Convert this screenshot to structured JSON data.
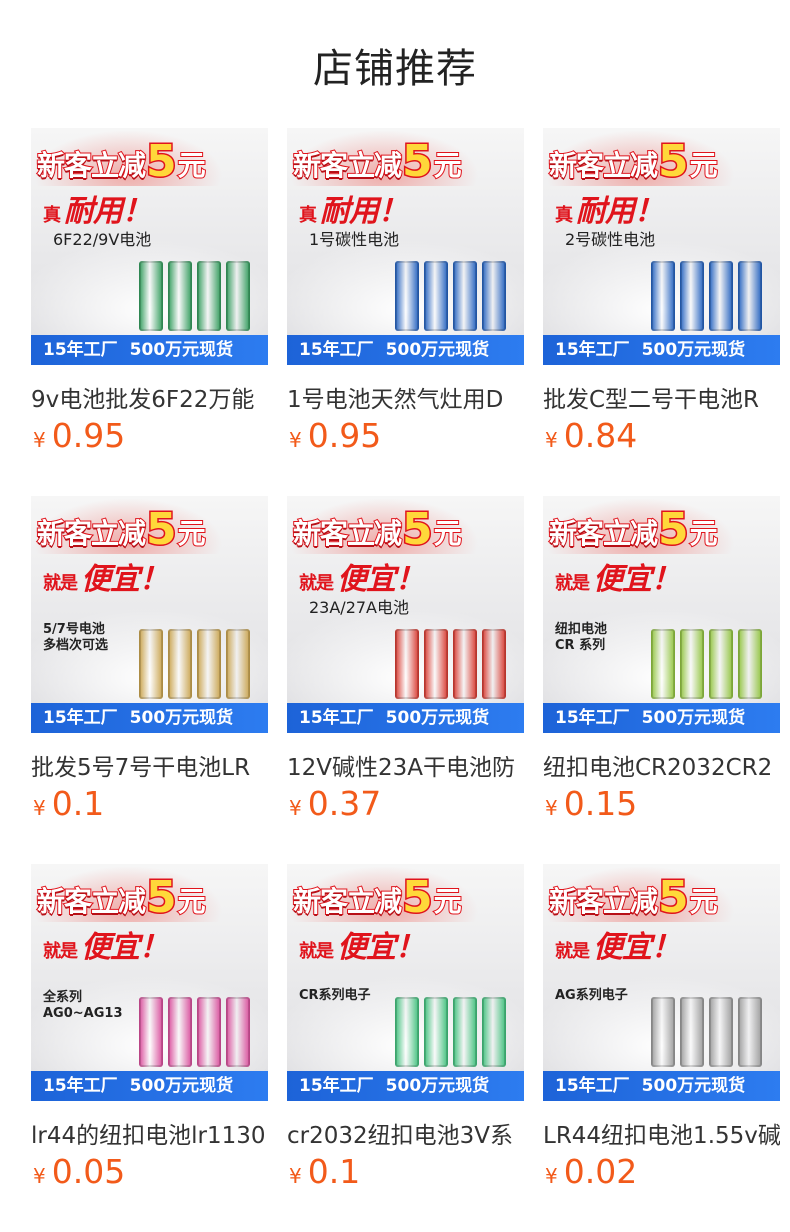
{
  "page_title": "店铺推荐",
  "promo": {
    "a": "新客立减",
    "b": "5",
    "c": "元"
  },
  "slogans": {
    "durable_small": "真",
    "durable": "耐用！",
    "cheap_small": "就是",
    "cheap": "便宜！"
  },
  "banner": {
    "left": "15年工厂",
    "right": "500万元现货"
  },
  "currency": "¥",
  "products": [
    {
      "name": "9v电池批发6F22万能",
      "price": "0.95",
      "slogan": "durable",
      "sub": "6F22/9V电池",
      "sub2": "",
      "product_color": "#2f9b5a"
    },
    {
      "name": "1号电池天然气灶用D",
      "price": "0.95",
      "slogan": "durable",
      "sub": "1号碳性电池",
      "sub2": "",
      "product_color": "#1f5fbf"
    },
    {
      "name": "批发C型二号干电池R",
      "price": "0.84",
      "slogan": "durable",
      "sub": "2号碳性电池",
      "sub2": "",
      "product_color": "#1f5fbf"
    },
    {
      "name": "批发5号7号干电池LR",
      "price": "0.1",
      "slogan": "cheap",
      "sub": "",
      "sub2": "5/7号电池\n多档次可选",
      "product_color": "#c9a24a"
    },
    {
      "name": "12V碱性23A干电池防",
      "price": "0.37",
      "slogan": "cheap",
      "sub": "23A/27A电池",
      "sub2": "",
      "product_color": "#d9362c"
    },
    {
      "name": "纽扣电池CR2032CR2",
      "price": "0.15",
      "slogan": "cheap",
      "sub": "",
      "sub2": "纽扣电池\nCR 系列",
      "product_color": "#8fc33a"
    },
    {
      "name": "lr44的纽扣电池lr1130",
      "price": "0.05",
      "slogan": "cheap",
      "sub": "",
      "sub2": "全系列\nAG0~AG13",
      "product_color": "#d94a9a"
    },
    {
      "name": "cr2032纽扣电池3V系",
      "price": "0.1",
      "slogan": "cheap",
      "sub": "",
      "sub2": "CR系列电子",
      "product_color": "#3cc07a"
    },
    {
      "name": "LR44纽扣电池1.55v碱",
      "price": "0.02",
      "slogan": "cheap",
      "sub": "",
      "sub2": "AG系列电子",
      "product_color": "#9a9a9a"
    }
  ]
}
